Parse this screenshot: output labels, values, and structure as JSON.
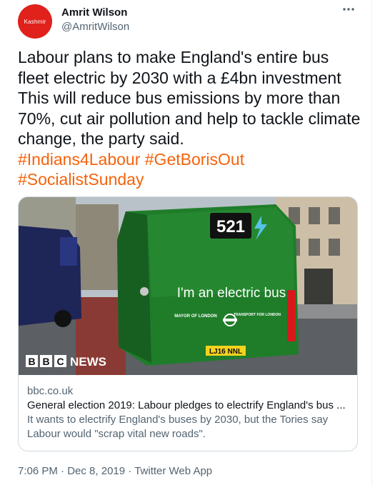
{
  "author": {
    "avatar_text": "Kashmir",
    "name": "Amrit Wilson",
    "handle": "@AmritWilson",
    "more_icon": "more-horizontal-icon"
  },
  "tweet": {
    "text": "Labour plans to make England's entire bus fleet electric by 2030 with a £4bn investment This will reduce bus emissions by more than 70%, cut air pollution and help to tackle climate change, the party said.",
    "hashtags": [
      "#Indians4Labour",
      "#GetBorisOut",
      "#SocialistSunday"
    ]
  },
  "link_card": {
    "image": {
      "route_number": "521",
      "bus_slogan": "I'm an electric bus",
      "mayor_text": "MAYOR OF LONDON",
      "tfl_text": "TRANSPORT FOR LONDON",
      "plate": "LJ16 NNL",
      "brand_letters": [
        "B",
        "B",
        "C"
      ],
      "brand_word": "NEWS"
    },
    "domain": "bbc.co.uk",
    "title": "General election 2019: Labour pledges to electrify England's bus ...",
    "description": "It wants to electrify England's buses by 2030, but the Tories say Labour would \"scrap vital new roads\"."
  },
  "meta": {
    "time": "7:06 PM",
    "date": "Dec 8, 2019",
    "source": "Twitter Web App",
    "separator": "·"
  },
  "colors": {
    "hashtag": "#f4630b",
    "avatar": "#e0211c",
    "secondary_text": "#536471",
    "bus_green": "#1f7d2a"
  }
}
